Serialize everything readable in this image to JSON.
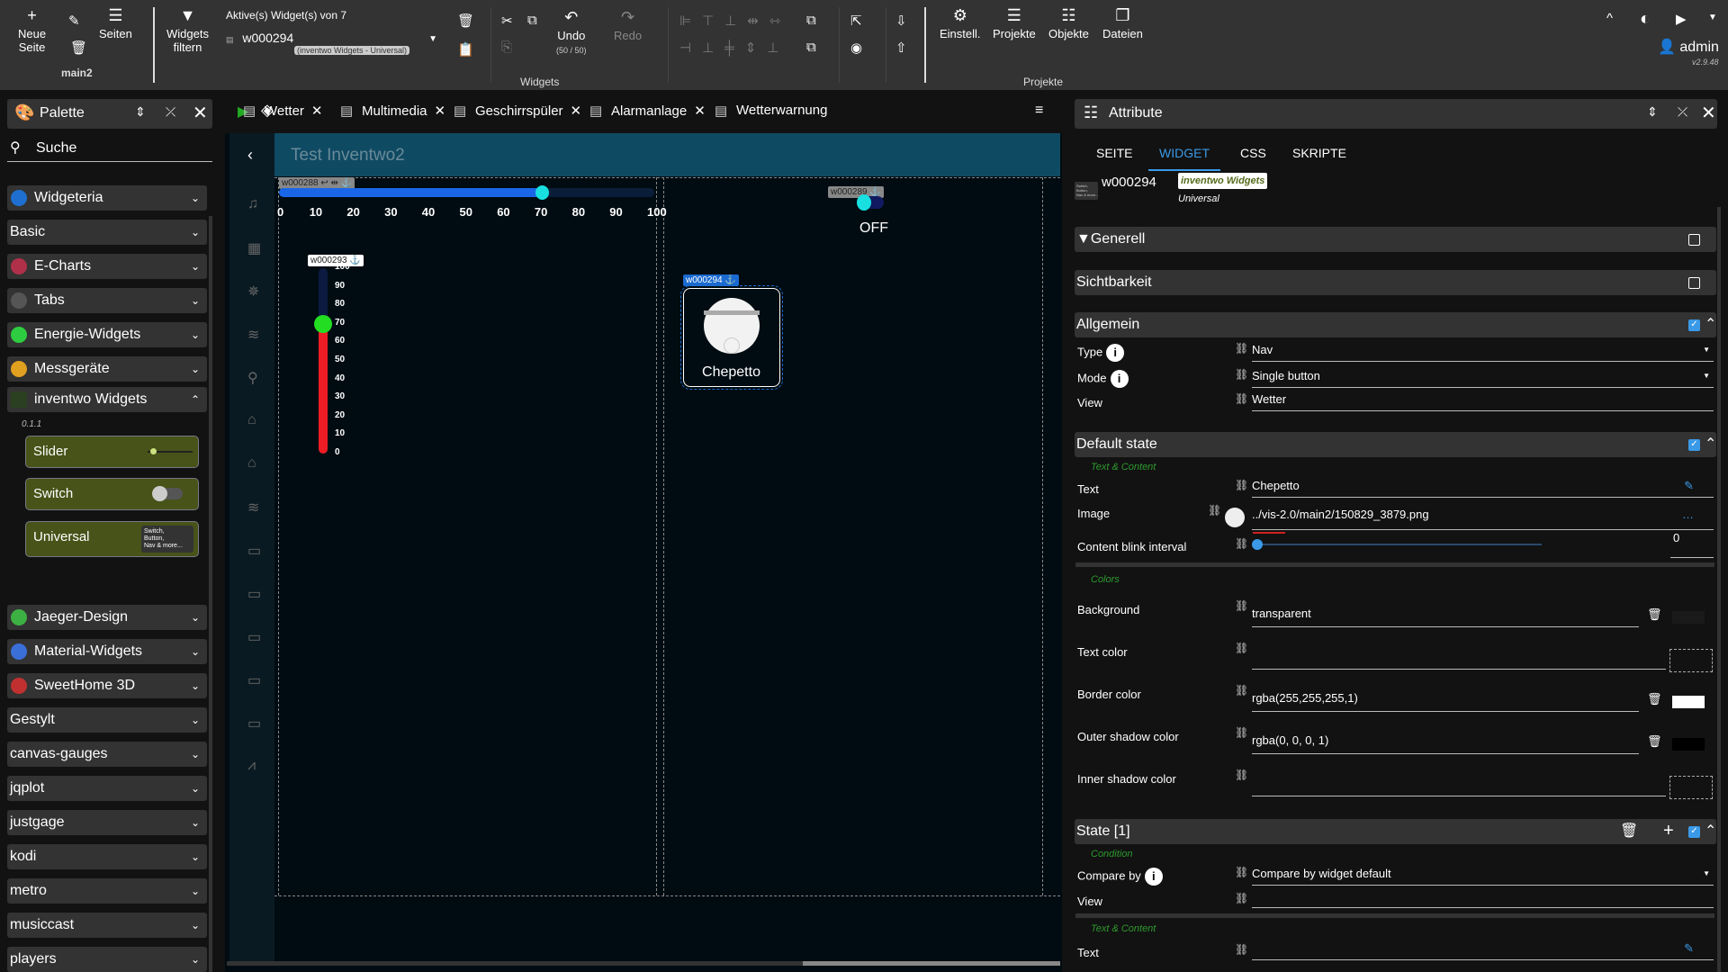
{
  "toolbar": {
    "new_page": "Neue\nSeite",
    "pages": "Seiten",
    "page_name": "main2",
    "filter": "Widgets\nfiltern",
    "active_widgets": "Aktive(s) Widget(s) von 7",
    "selected_widget": "w000294",
    "selected_widget_sub": "(inventwo Widgets - Universal)",
    "undo": "Undo",
    "undo_count": "(50 / 50)",
    "redo": "Redo",
    "widgets_group": "Widgets",
    "settings": "Einstell.",
    "projects": "Projekte",
    "objects": "Objekte",
    "files": "Dateien",
    "projects_group": "Projekte",
    "user": "admin",
    "version": "v2.9.48"
  },
  "palette": {
    "title": "Palette",
    "search_placeholder": "Suche",
    "groups_top": [
      {
        "label": "Widgeteria",
        "color": "#1e6fd0"
      },
      {
        "label": "Basic",
        "color": ""
      },
      {
        "label": "E-Charts",
        "color": "#b0304a"
      },
      {
        "label": "Tabs",
        "color": "#555"
      },
      {
        "label": "Energie-Widgets",
        "color": "#2ecc40"
      },
      {
        "label": "Messgeräte",
        "color": "#e0a020"
      }
    ],
    "open_group": {
      "label": "inventwo Widgets",
      "version": "0.1.1",
      "widgets": [
        {
          "label": "Slider"
        },
        {
          "label": "Switch"
        },
        {
          "label": "Universal",
          "preview": "Switch,\nButton,\nNav & more..."
        }
      ]
    },
    "groups_bottom": [
      {
        "label": "Jaeger-Design",
        "color": "#3cb043"
      },
      {
        "label": "Material-Widgets",
        "color": "#3a6fd8"
      },
      {
        "label": "SweetHome 3D",
        "color": "#c03030"
      },
      {
        "label": "Gestylt",
        "color": ""
      },
      {
        "label": "canvas-gauges",
        "color": ""
      },
      {
        "label": "jqplot",
        "color": ""
      },
      {
        "label": "justgage",
        "color": ""
      },
      {
        "label": "kodi",
        "color": ""
      },
      {
        "label": "metro",
        "color": ""
      },
      {
        "label": "musiccast",
        "color": ""
      },
      {
        "label": "players",
        "color": ""
      }
    ]
  },
  "view_tabs": [
    {
      "label": "Wetter",
      "closable": true
    },
    {
      "label": "Multimedia",
      "closable": true
    },
    {
      "label": "Geschirrspüler",
      "closable": true
    },
    {
      "label": "Alarmanlage",
      "closable": true
    },
    {
      "label": "Wetterwarnung",
      "closable": false
    }
  ],
  "canvas": {
    "view_title": "Test Inventwo2",
    "hslider": {
      "id": "w000288",
      "value": 70,
      "min": 0,
      "max": 100,
      "ticks": [
        0,
        10,
        20,
        30,
        40,
        50,
        60,
        70,
        80,
        90,
        100
      ],
      "color": "#1a66e8",
      "thumb": "#19e0e0"
    },
    "switch": {
      "id": "w000289",
      "state": "OFF"
    },
    "vslider": {
      "id": "w000293",
      "value": 70,
      "ticks": [
        100,
        90,
        80,
        70,
        60,
        50,
        40,
        30,
        20,
        10,
        0
      ],
      "fill": "#ee1c25",
      "thumb": "#22dd22"
    },
    "button": {
      "id": "w000294",
      "text": "Chepetto"
    }
  },
  "attributes": {
    "title": "Attribute",
    "tabs": [
      "SEITE",
      "WIDGET",
      "CSS",
      "SKRIPTE"
    ],
    "active_tab": "WIDGET",
    "widget_id": "w000294",
    "widget_set": "inventwo Widgets",
    "widget_type": "Universal",
    "widget_preview": "Switch,\nButton,\nNav & more...",
    "sections": {
      "general": "Generell",
      "visibility": "Sichtbarkeit",
      "common": "Allgemein",
      "default_state": "Default state",
      "state1": "State [1]"
    },
    "common": {
      "type_label": "Type",
      "type_value": "Nav",
      "mode_label": "Mode",
      "mode_value": "Single button",
      "view_label": "View",
      "view_value": "Wetter"
    },
    "default_state": {
      "text_content": "Text & Content",
      "text_label": "Text",
      "text_value": "Chepetto",
      "image_label": "Image",
      "image_value": "../vis-2.0/main2/150829_3879.png",
      "blink_label": "Content blink interval",
      "blink_value": "0",
      "colors": "Colors",
      "bg_label": "Background",
      "bg_value": "transparent",
      "textcolor_label": "Text color",
      "textcolor_value": "",
      "border_label": "Border color",
      "border_value": "rgba(255,255,255,1)",
      "outer_label": "Outer shadow color",
      "outer_value": "rgba(0, 0, 0, 1)",
      "inner_label": "Inner shadow color",
      "inner_value": ""
    },
    "state1": {
      "condition": "Condition",
      "compare_label": "Compare by",
      "compare_value": "Compare by widget default",
      "view_label": "View",
      "view_value": "",
      "text_content": "Text & Content",
      "text_label": "Text",
      "text_value": ""
    }
  }
}
